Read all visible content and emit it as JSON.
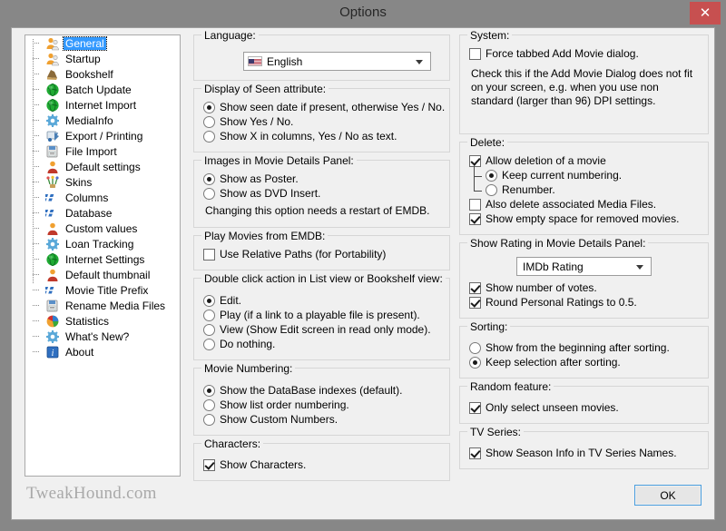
{
  "window": {
    "title": "Options",
    "close_label": "✕"
  },
  "sidebar": {
    "items": [
      {
        "label": "General",
        "icon": "users-icon",
        "selected": true
      },
      {
        "label": "Startup",
        "icon": "users-icon",
        "selected": false
      },
      {
        "label": "Bookshelf",
        "icon": "bookshelf-icon",
        "selected": false
      },
      {
        "label": "Batch Update",
        "icon": "globe-icon",
        "selected": false
      },
      {
        "label": "Internet Import",
        "icon": "globe-icon",
        "selected": false
      },
      {
        "label": "MediaInfo",
        "icon": "gear-icon",
        "selected": false
      },
      {
        "label": "Export / Printing",
        "icon": "export-icon",
        "selected": false
      },
      {
        "label": "File Import",
        "icon": "file-import-icon",
        "selected": false
      },
      {
        "label": "Default settings",
        "icon": "person-icon",
        "selected": false
      },
      {
        "label": "Skins",
        "icon": "skins-icon",
        "selected": false
      },
      {
        "label": "Columns",
        "icon": "columns-icon",
        "selected": false
      },
      {
        "label": "Database",
        "icon": "columns-icon",
        "selected": false
      },
      {
        "label": "Custom values",
        "icon": "person-icon",
        "selected": false
      },
      {
        "label": "Loan Tracking",
        "icon": "gear-icon",
        "selected": false
      },
      {
        "label": "Internet Settings",
        "icon": "globe-icon",
        "selected": false
      },
      {
        "label": "Default thumbnail",
        "icon": "person-icon",
        "selected": false
      },
      {
        "label": "Movie Title Prefix",
        "icon": "columns-icon",
        "selected": false
      },
      {
        "label": "Rename Media Files",
        "icon": "file-import-icon",
        "selected": false
      },
      {
        "label": "Statistics",
        "icon": "pie-chart-icon",
        "selected": false
      },
      {
        "label": "What's New?",
        "icon": "gear-icon",
        "selected": false
      },
      {
        "label": "About",
        "icon": "info-icon",
        "selected": false
      }
    ]
  },
  "left_column": {
    "language": {
      "title": "Language:",
      "selected": "English",
      "flag": "us-flag-icon"
    },
    "seen_attribute": {
      "title": "Display of Seen attribute:",
      "options": [
        {
          "label": "Show seen date if present, otherwise Yes / No.",
          "selected": true
        },
        {
          "label": "Show Yes / No.",
          "selected": false
        },
        {
          "label": "Show X in columns, Yes / No as text.",
          "selected": false
        }
      ]
    },
    "images_panel": {
      "title": "Images in Movie Details Panel:",
      "options": [
        {
          "label": "Show as Poster.",
          "selected": true
        },
        {
          "label": "Show as DVD Insert.",
          "selected": false
        }
      ],
      "note": "Changing this option needs a restart of EMDB."
    },
    "play_movies": {
      "title": "Play Movies from EMDB:",
      "checkbox": {
        "label": "Use Relative Paths (for Portability)",
        "checked": false
      }
    },
    "double_click": {
      "title": "Double click action in List view or Bookshelf view:",
      "options": [
        {
          "label": "Edit.",
          "selected": true
        },
        {
          "label": "Play (if a link to a playable file is present).",
          "selected": false
        },
        {
          "label": "View (Show Edit screen in read only mode).",
          "selected": false
        },
        {
          "label": "Do nothing.",
          "selected": false
        }
      ]
    },
    "movie_numbering": {
      "title": "Movie Numbering:",
      "options": [
        {
          "label": "Show the DataBase indexes (default).",
          "selected": true
        },
        {
          "label": "Show list order numbering.",
          "selected": false
        },
        {
          "label": "Show Custom Numbers.",
          "selected": false
        }
      ]
    },
    "characters": {
      "title": "Characters:",
      "checkbox": {
        "label": "Show Characters.",
        "checked": true
      }
    }
  },
  "right_column": {
    "system": {
      "title": "System:",
      "checkbox": {
        "label": "Force tabbed Add Movie dialog.",
        "checked": false
      },
      "note": "Check this if the Add Movie Dialog does not fit on your screen, e.g. when you use non standard (larger than 96) DPI settings."
    },
    "delete": {
      "title": "Delete:",
      "allow": {
        "label": "Allow deletion of a movie",
        "checked": true
      },
      "numbering_options": [
        {
          "label": "Keep current numbering.",
          "selected": true
        },
        {
          "label": "Renumber.",
          "selected": false
        }
      ],
      "also_delete": {
        "label": "Also delete associated Media Files.",
        "checked": false
      },
      "show_empty": {
        "label": "Show empty space for removed movies.",
        "checked": true
      }
    },
    "rating": {
      "title": "Show Rating in Movie Details Panel:",
      "selected": "IMDb Rating",
      "show_votes": {
        "label": "Show number of votes.",
        "checked": true
      },
      "round_ratings": {
        "label": "Round Personal Ratings to 0.5.",
        "checked": true
      }
    },
    "sorting": {
      "title": "Sorting:",
      "options": [
        {
          "label": "Show from the beginning after sorting.",
          "selected": false
        },
        {
          "label": "Keep selection after sorting.",
          "selected": true
        }
      ]
    },
    "random": {
      "title": "Random feature:",
      "checkbox": {
        "label": "Only select unseen movies.",
        "checked": true
      }
    },
    "tv_series": {
      "title": "TV Series:",
      "checkbox": {
        "label": "Show Season Info in TV Series Names.",
        "checked": true
      }
    }
  },
  "footer": {
    "watermark": "TweakHound.com",
    "ok_label": "OK"
  },
  "colors": {
    "titlebar": "#878787",
    "close_button": "#c75050",
    "selection": "#3399ff",
    "client_bg": "#f0f0f0",
    "focus_border": "#4a9ede"
  }
}
